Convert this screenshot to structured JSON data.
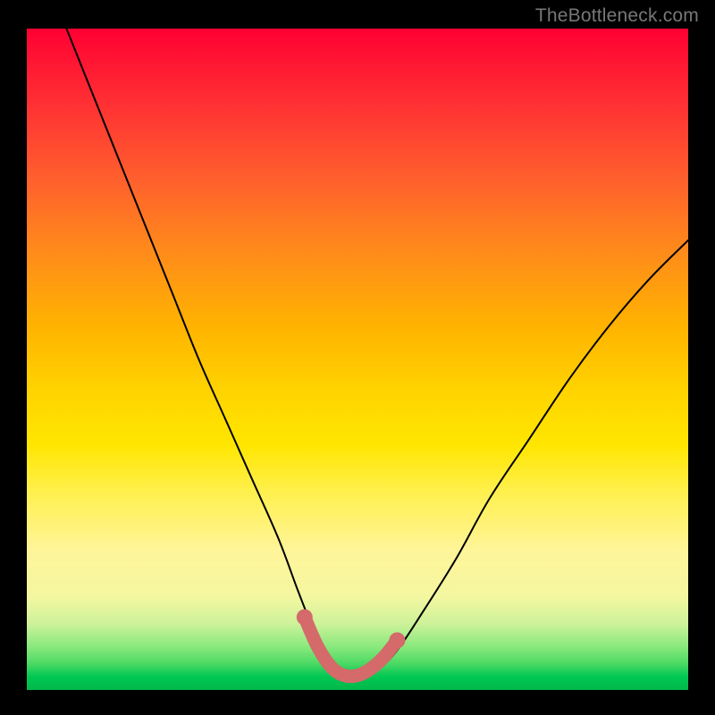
{
  "watermark": "TheBottleneck.com",
  "chart_data": {
    "type": "line",
    "title": "",
    "xlabel": "",
    "ylabel": "",
    "xlim": [
      0,
      100
    ],
    "ylim": [
      0,
      100
    ],
    "grid": false,
    "legend": false,
    "series": [
      {
        "name": "bottleneck-curve",
        "x": [
          6,
          10,
          14,
          18,
          22,
          26,
          30,
          34,
          38,
          41,
          43,
          45,
          47,
          49,
          51,
          53,
          56,
          60,
          65,
          70,
          76,
          82,
          88,
          94,
          100
        ],
        "y": [
          100,
          90,
          80,
          70,
          60,
          50,
          41,
          32,
          23,
          15,
          10,
          6,
          3,
          2,
          2,
          3,
          6,
          12,
          20,
          29,
          38,
          47,
          55,
          62,
          68
        ]
      }
    ],
    "highlight": {
      "name": "optimal-zone",
      "x": [
        42,
        44,
        46,
        48,
        50,
        52,
        54,
        56
      ],
      "y": [
        11,
        6.5,
        3.5,
        2.2,
        2.2,
        3.2,
        5,
        7.5
      ]
    },
    "background_gradient": {
      "orientation": "vertical",
      "stops": [
        {
          "pos": 0.0,
          "color": "#ff0033"
        },
        {
          "pos": 0.35,
          "color": "#ff8c1a"
        },
        {
          "pos": 0.6,
          "color": "#ffe600"
        },
        {
          "pos": 0.8,
          "color": "#fff59a"
        },
        {
          "pos": 0.93,
          "color": "#88e97c"
        },
        {
          "pos": 1.0,
          "color": "#00b74a"
        }
      ]
    }
  }
}
